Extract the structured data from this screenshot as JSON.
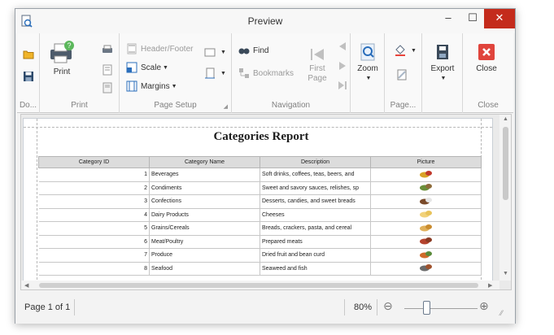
{
  "window": {
    "title": "Preview"
  },
  "ribbon": {
    "document": {
      "group_label": "Do..."
    },
    "print": {
      "print_label": "Print",
      "group_label": "Print"
    },
    "page_setup": {
      "header_footer_label": "Header/Footer",
      "scale_label": "Scale",
      "margins_label": "Margins",
      "group_label": "Page Setup"
    },
    "navigation": {
      "find_label": "Find",
      "bookmarks_label": "Bookmarks",
      "first_page_label": "First Page",
      "group_label": "Navigation"
    },
    "zoom": {
      "zoom_label": "Zoom"
    },
    "page_background": {
      "group_label": "Page..."
    },
    "export": {
      "export_label": "Export"
    },
    "close": {
      "close_label": "Close",
      "group_label": "Close"
    }
  },
  "report": {
    "title": "Categories Report",
    "columns": [
      "Category ID",
      "Category Name",
      "Description",
      "Picture"
    ],
    "rows": [
      [
        "1",
        "Beverages",
        "Soft drinks, coffees, teas, beers, and"
      ],
      [
        "2",
        "Condiments",
        "Sweet and savory sauces, relishes, sp"
      ],
      [
        "3",
        "Confections",
        "Desserts, candies, and sweet breads"
      ],
      [
        "4",
        "Dairy Products",
        "Cheeses"
      ],
      [
        "5",
        "Grains/Cereals",
        "Breads, crackers, pasta, and cereal"
      ],
      [
        "6",
        "Meat/Poultry",
        "Prepared meats"
      ],
      [
        "7",
        "Produce",
        "Dried fruit and bean curd"
      ],
      [
        "8",
        "Seafood",
        "Seaweed and fish"
      ]
    ]
  },
  "status": {
    "page_label": "Page 1 of 1",
    "zoom_label": "80%",
    "zoom_fraction": 0.3
  },
  "colors": {
    "close_button": "#c42b1c",
    "accent": "#2a6ebb"
  }
}
